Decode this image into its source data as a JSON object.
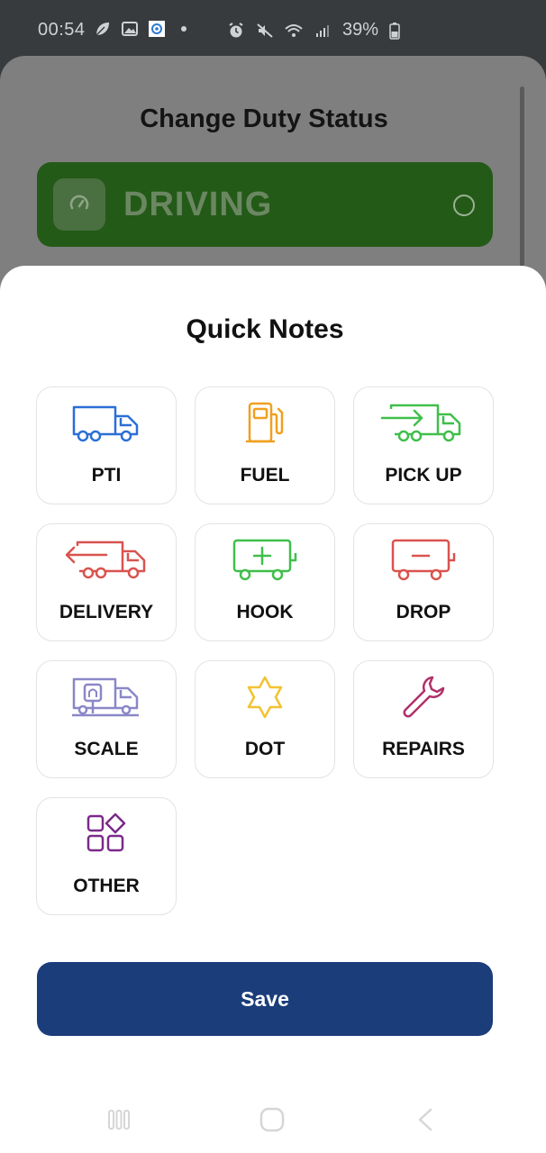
{
  "status_bar": {
    "time": "00:54",
    "battery": "39%",
    "left_icons": [
      "leaf-icon",
      "gallery-icon",
      "app-icon",
      "dot-icon"
    ],
    "right_icons": [
      "alarm-icon",
      "mute-icon",
      "wifi-icon",
      "signal-icon",
      "battery-icon"
    ]
  },
  "background": {
    "title": "Change Duty Status",
    "status_option": "DRIVING",
    "status_icon": "speedometer-icon"
  },
  "sheet": {
    "title": "Quick Notes",
    "notes": [
      {
        "label": "PTI",
        "icon": "truck-icon",
        "color": "#2b6fd6"
      },
      {
        "label": "FUEL",
        "icon": "fuel-pump-icon",
        "color": "#f0a020"
      },
      {
        "label": "PICK UP",
        "icon": "truck-arrow-in-icon",
        "color": "#3fbf4a"
      },
      {
        "label": "DELIVERY",
        "icon": "truck-arrow-out-icon",
        "color": "#d9534f"
      },
      {
        "label": "HOOK",
        "icon": "trailer-plus-icon",
        "color": "#3fbf4a"
      },
      {
        "label": "DROP",
        "icon": "trailer-minus-icon",
        "color": "#d9534f"
      },
      {
        "label": "SCALE",
        "icon": "truck-scale-icon",
        "color": "#8a87c8"
      },
      {
        "label": "DOT",
        "icon": "star-badge-icon",
        "color": "#f2c230"
      },
      {
        "label": "REPAIRS",
        "icon": "wrench-icon",
        "color": "#b0306a"
      },
      {
        "label": "OTHER",
        "icon": "grid-shapes-icon",
        "color": "#7b2a8a"
      }
    ],
    "save_label": "Save"
  },
  "nav_bar": {
    "icons": [
      "recent-apps-icon",
      "home-icon",
      "back-icon"
    ]
  }
}
